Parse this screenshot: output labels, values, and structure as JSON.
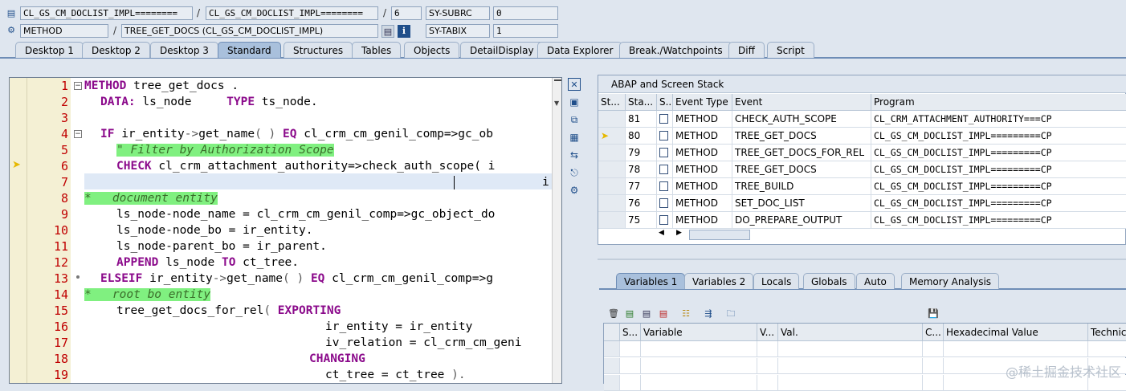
{
  "header": {
    "program_field_1": "CL_GS_CM_DOCLIST_IMPL========",
    "program_field_2": "CL_GS_CM_DOCLIST_IMPL========",
    "line_number": "6",
    "sy_subrc_label": "SY-SUBRC",
    "sy_subrc_value": "0",
    "event_type": "METHOD",
    "event_name": "TREE_GET_DOCS (CL_GS_CM_DOCLIST_IMPL)",
    "sy_tabix_label": "SY-TABIX",
    "sy_tabix_value": "1",
    "separator": "/"
  },
  "tabs": [
    {
      "label": "Desktop 1"
    },
    {
      "label": "Desktop 2"
    },
    {
      "label": "Desktop 3"
    },
    {
      "label": "Standard"
    },
    {
      "label": "Structures"
    },
    {
      "label": "Tables"
    },
    {
      "label": "Objects"
    },
    {
      "label": "DetailDisplay"
    },
    {
      "label": "Data Explorer"
    },
    {
      "label": "Break./Watchpoints"
    },
    {
      "label": "Diff"
    },
    {
      "label": "Script"
    }
  ],
  "editor": {
    "current_line": 6,
    "lines": [
      {
        "n": "1"
      },
      {
        "n": "2"
      },
      {
        "n": "3"
      },
      {
        "n": "4"
      },
      {
        "n": "5"
      },
      {
        "n": "6"
      },
      {
        "n": "7"
      },
      {
        "n": "8"
      },
      {
        "n": "9"
      },
      {
        "n": "10"
      },
      {
        "n": "11"
      },
      {
        "n": "12"
      },
      {
        "n": "13"
      },
      {
        "n": "14"
      },
      {
        "n": "15"
      },
      {
        "n": "16"
      },
      {
        "n": "17"
      },
      {
        "n": "18"
      },
      {
        "n": "19"
      }
    ],
    "code": {
      "l1_kw": "METHOD",
      "l1_rest": " tree_get_docs .",
      "l2_kw1": "DATA:",
      "l2_mid": " ls_node     ",
      "l2_kw2": "TYPE",
      "l2_rest": " ts_node.",
      "l4_kw1": "IF",
      "l4_a": " ir_entity",
      "l4_op1": "->",
      "l4_b": "get_name",
      "l4_op2": "( )",
      "l4_kw2": " EQ",
      "l4_c": " cl_crm_cm_genil_comp=>gc_ob",
      "l5_comment": "\" Filter by Authorization Scope",
      "l6_kw": "CHECK",
      "l6_rest": " cl_crm_attachment_authority=>check_auth_scope( i",
      "l7_rest": "i",
      "l8_comment": "*   document entity",
      "l9": "ls_node-node_name = cl_crm_cm_genil_comp=>gc_object_do",
      "l10": "ls_node-node_bo = ir_entity.",
      "l11": "ls_node-parent_bo = ir_parent.",
      "l12_kw1": "APPEND",
      "l12_mid": " ls_node ",
      "l12_kw2": "TO",
      "l12_rest": " ct_tree.",
      "l13_kw1": "ELSEIF",
      "l13_a": " ir_entity",
      "l13_op1": "->",
      "l13_b": "get_name",
      "l13_op2": "( )",
      "l13_kw2": " EQ",
      "l13_c": " cl_crm_cm_genil_comp=>g",
      "l14_comment": "*   root bo entity",
      "l15_a": "tree_get_docs_for_rel",
      "l15_op": "(",
      "l15_kw": " EXPORTING",
      "l16": "ir_entity = ir_entity",
      "l17": "iv_relation = cl_crm_cm_geni",
      "l18_kw": "CHANGING",
      "l19": "ct_tree = ct_tree ",
      "l19_op": ")."
    }
  },
  "stack": {
    "title": "ABAP and Screen Stack",
    "columns": [
      "St...",
      "Sta...",
      "S...",
      "Event Type",
      "Event",
      "Program"
    ],
    "rows": [
      {
        "level": "81",
        "type": "METHOD",
        "event": "CHECK_AUTH_SCOPE",
        "program": "CL_CRM_ATTACHMENT_AUTHORITY===CP",
        "current": false
      },
      {
        "level": "80",
        "type": "METHOD",
        "event": "TREE_GET_DOCS",
        "program": "CL_GS_CM_DOCLIST_IMPL=========CP",
        "current": true
      },
      {
        "level": "79",
        "type": "METHOD",
        "event": "TREE_GET_DOCS_FOR_REL",
        "program": "CL_GS_CM_DOCLIST_IMPL=========CP",
        "current": false
      },
      {
        "level": "78",
        "type": "METHOD",
        "event": "TREE_GET_DOCS",
        "program": "CL_GS_CM_DOCLIST_IMPL=========CP",
        "current": false
      },
      {
        "level": "77",
        "type": "METHOD",
        "event": "TREE_BUILD",
        "program": "CL_GS_CM_DOCLIST_IMPL=========CP",
        "current": false
      },
      {
        "level": "76",
        "type": "METHOD",
        "event": "SET_DOC_LIST",
        "program": "CL_GS_CM_DOCLIST_IMPL=========CP",
        "current": false
      },
      {
        "level": "75",
        "type": "METHOD",
        "event": "DO_PREPARE_OUTPUT",
        "program": "CL_GS_CM_DOCLIST_IMPL=========CP",
        "current": false
      }
    ]
  },
  "var_tabs": [
    {
      "label": "Variables 1"
    },
    {
      "label": "Variables 2"
    },
    {
      "label": "Locals"
    },
    {
      "label": "Globals"
    },
    {
      "label": "Auto"
    },
    {
      "label": "Memory Analysis"
    }
  ],
  "vars": {
    "columns": [
      "S...",
      "Variable",
      "V...",
      "Val.",
      "C...",
      "Hexadecimal Value",
      "Technica"
    ]
  },
  "watermark": "@稀土掘金技术社区",
  "colors": {
    "keyword": "#8b0a8b",
    "comment_bg": "#80f080",
    "line_number": "#c00000",
    "active_tab": "#a9c0dc"
  }
}
